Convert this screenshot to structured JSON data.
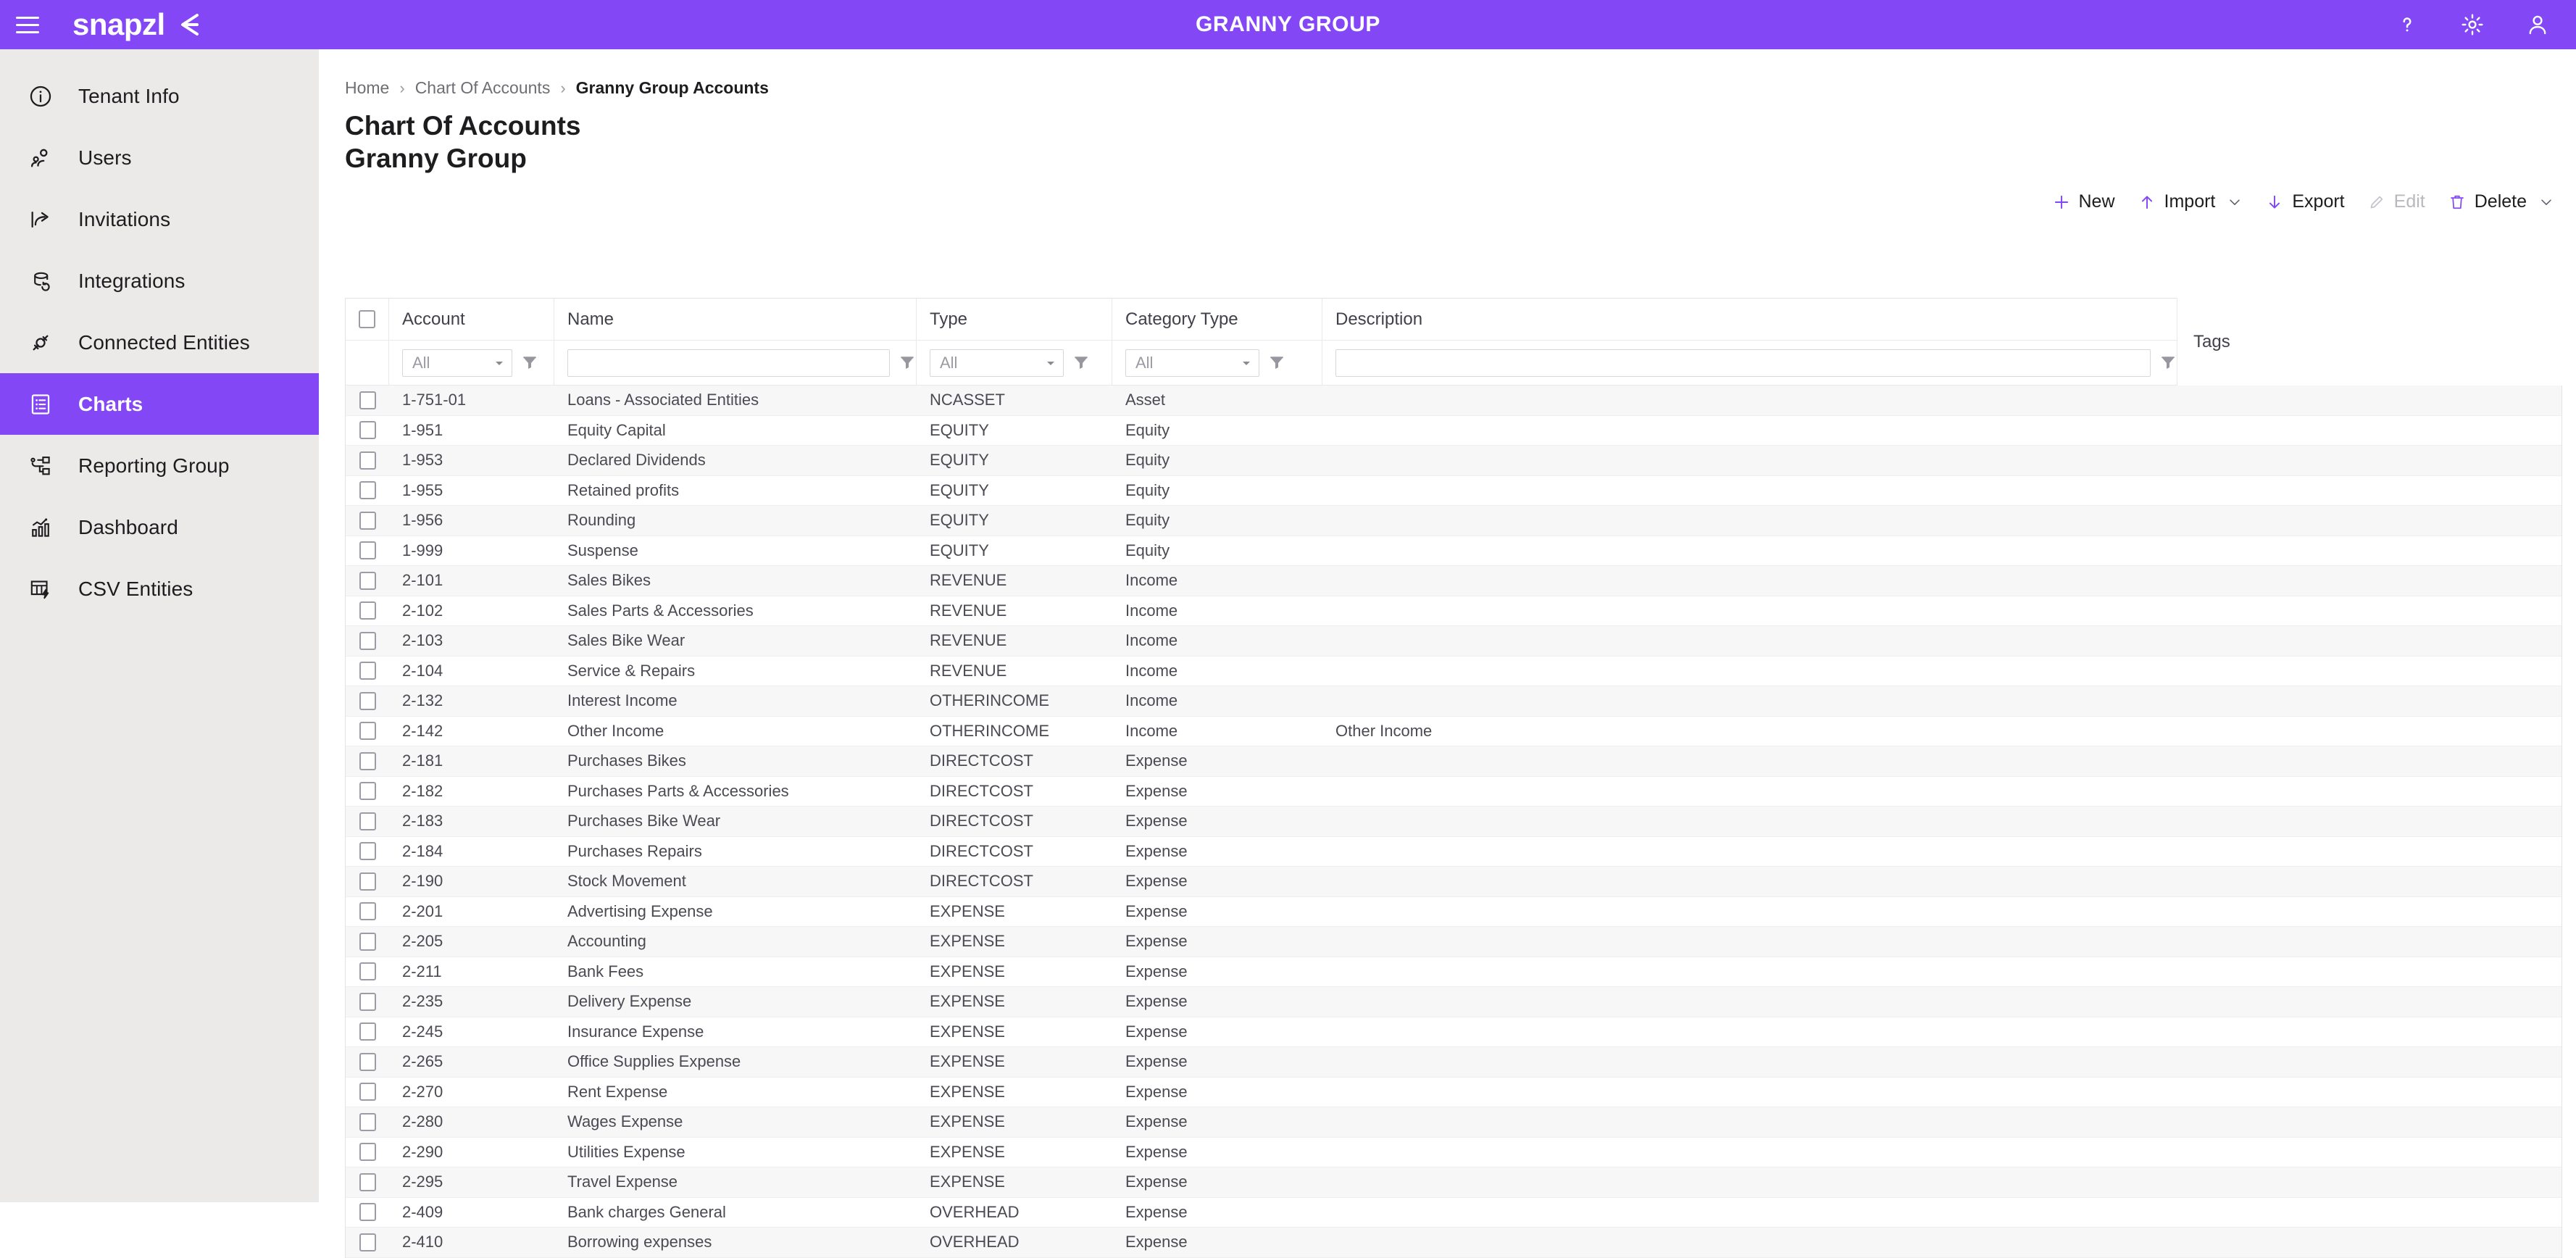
{
  "topbar": {
    "brand": "snapzl",
    "title": "GRANNY GROUP",
    "menu_icon": "hamburger-icon",
    "help_icon": "help-icon",
    "settings_icon": "gear-icon",
    "account_icon": "user-icon"
  },
  "sidebar": {
    "items": [
      {
        "label": "Tenant Info",
        "icon": "info-circle-icon",
        "active": false
      },
      {
        "label": "Users",
        "icon": "users-icon",
        "active": false
      },
      {
        "label": "Invitations",
        "icon": "share-arrow-icon",
        "active": false
      },
      {
        "label": "Integrations",
        "icon": "sync-database-icon",
        "active": false
      },
      {
        "label": "Connected Entities",
        "icon": "plug-icon",
        "active": false
      },
      {
        "label": "Charts",
        "icon": "list-document-icon",
        "active": true
      },
      {
        "label": "Reporting Group",
        "icon": "hierarchy-icon",
        "active": false
      },
      {
        "label": "Dashboard",
        "icon": "bar-chart-icon",
        "active": false
      },
      {
        "label": "CSV Entities",
        "icon": "table-bolt-icon",
        "active": false
      }
    ]
  },
  "breadcrumb": {
    "home": "Home",
    "parent": "Chart Of Accounts",
    "current": "Granny Group Accounts",
    "separator": "›"
  },
  "page": {
    "title": "Chart Of Accounts",
    "subtitle": "Granny Group"
  },
  "toolbar": {
    "new_label": "New",
    "import_label": "Import",
    "export_label": "Export",
    "edit_label": "Edit",
    "delete_label": "Delete"
  },
  "table": {
    "columns": [
      "Account",
      "Name",
      "Type",
      "Category Type",
      "Description",
      "Tags"
    ],
    "filters": {
      "account": "All",
      "name": "",
      "type": "All",
      "category_type": "All",
      "description": ""
    },
    "rows": [
      {
        "account": "1-751-01",
        "name": "Loans - Associated Entities",
        "type": "NCASSET",
        "category": "Asset",
        "description": ""
      },
      {
        "account": "1-951",
        "name": "Equity Capital",
        "type": "EQUITY",
        "category": "Equity",
        "description": ""
      },
      {
        "account": "1-953",
        "name": "Declared Dividends",
        "type": "EQUITY",
        "category": "Equity",
        "description": ""
      },
      {
        "account": "1-955",
        "name": "Retained profits",
        "type": "EQUITY",
        "category": "Equity",
        "description": ""
      },
      {
        "account": "1-956",
        "name": "Rounding",
        "type": "EQUITY",
        "category": "Equity",
        "description": ""
      },
      {
        "account": "1-999",
        "name": "Suspense",
        "type": "EQUITY",
        "category": "Equity",
        "description": ""
      },
      {
        "account": "2-101",
        "name": "Sales Bikes",
        "type": "REVENUE",
        "category": "Income",
        "description": ""
      },
      {
        "account": "2-102",
        "name": "Sales Parts & Accessories",
        "type": "REVENUE",
        "category": "Income",
        "description": ""
      },
      {
        "account": "2-103",
        "name": "Sales Bike Wear",
        "type": "REVENUE",
        "category": "Income",
        "description": ""
      },
      {
        "account": "2-104",
        "name": "Service & Repairs",
        "type": "REVENUE",
        "category": "Income",
        "description": ""
      },
      {
        "account": "2-132",
        "name": "Interest Income",
        "type": "OTHERINCOME",
        "category": "Income",
        "description": ""
      },
      {
        "account": "2-142",
        "name": "Other Income",
        "type": "OTHERINCOME",
        "category": "Income",
        "description": "Other Income"
      },
      {
        "account": "2-181",
        "name": "Purchases Bikes",
        "type": "DIRECTCOST",
        "category": "Expense",
        "description": ""
      },
      {
        "account": "2-182",
        "name": "Purchases Parts & Accessories",
        "type": "DIRECTCOST",
        "category": "Expense",
        "description": ""
      },
      {
        "account": "2-183",
        "name": "Purchases Bike Wear",
        "type": "DIRECTCOST",
        "category": "Expense",
        "description": ""
      },
      {
        "account": "2-184",
        "name": "Purchases Repairs",
        "type": "DIRECTCOST",
        "category": "Expense",
        "description": ""
      },
      {
        "account": "2-190",
        "name": "Stock Movement",
        "type": "DIRECTCOST",
        "category": "Expense",
        "description": ""
      },
      {
        "account": "2-201",
        "name": "Advertising Expense",
        "type": "EXPENSE",
        "category": "Expense",
        "description": ""
      },
      {
        "account": "2-205",
        "name": "Accounting",
        "type": "EXPENSE",
        "category": "Expense",
        "description": ""
      },
      {
        "account": "2-211",
        "name": "Bank Fees",
        "type": "EXPENSE",
        "category": "Expense",
        "description": ""
      },
      {
        "account": "2-235",
        "name": "Delivery Expense",
        "type": "EXPENSE",
        "category": "Expense",
        "description": ""
      },
      {
        "account": "2-245",
        "name": "Insurance Expense",
        "type": "EXPENSE",
        "category": "Expense",
        "description": ""
      },
      {
        "account": "2-265",
        "name": "Office Supplies Expense",
        "type": "EXPENSE",
        "category": "Expense",
        "description": ""
      },
      {
        "account": "2-270",
        "name": "Rent Expense",
        "type": "EXPENSE",
        "category": "Expense",
        "description": ""
      },
      {
        "account": "2-280",
        "name": "Wages Expense",
        "type": "EXPENSE",
        "category": "Expense",
        "description": ""
      },
      {
        "account": "2-290",
        "name": "Utilities Expense",
        "type": "EXPENSE",
        "category": "Expense",
        "description": ""
      },
      {
        "account": "2-295",
        "name": "Travel Expense",
        "type": "EXPENSE",
        "category": "Expense",
        "description": ""
      },
      {
        "account": "2-409",
        "name": "Bank charges General",
        "type": "OVERHEAD",
        "category": "Expense",
        "description": ""
      },
      {
        "account": "2-410",
        "name": "Borrowing expenses",
        "type": "OVERHEAD",
        "category": "Expense",
        "description": ""
      }
    ]
  },
  "colors": {
    "brand_purple": "#8347F5",
    "sidebar_bg": "#ECEAE9",
    "row_stripe": "#F7F7F8"
  }
}
